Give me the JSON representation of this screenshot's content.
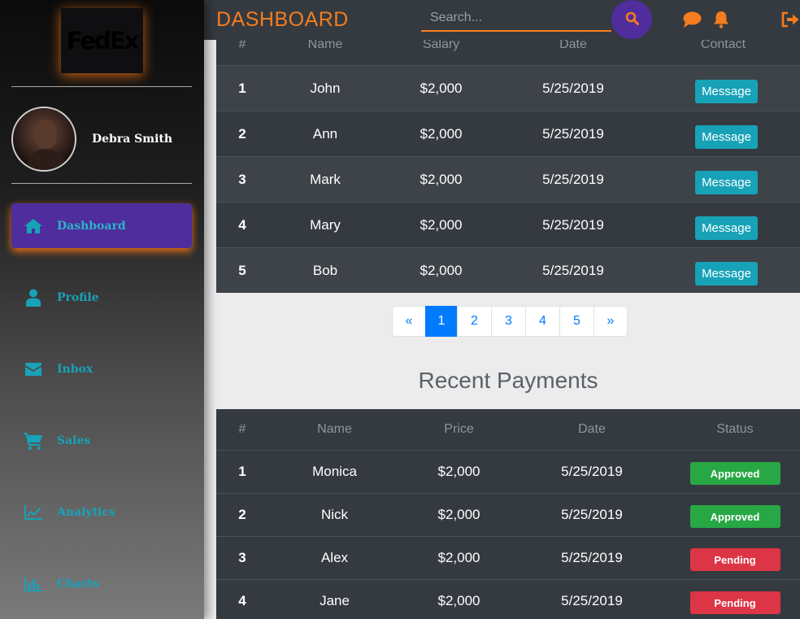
{
  "sidebar": {
    "logo": "FedEx",
    "user_name": "Debra Smith",
    "items": [
      {
        "label": "Dashboard",
        "icon": "home-icon"
      },
      {
        "label": "Profile",
        "icon": "user-icon"
      },
      {
        "label": "Inbox",
        "icon": "envelope-icon"
      },
      {
        "label": "Sales",
        "icon": "cart-icon"
      },
      {
        "label": "Analytics",
        "icon": "line-chart-icon"
      },
      {
        "label": "Charts",
        "icon": "bar-chart-icon"
      }
    ]
  },
  "header": {
    "title": "DASHBOARD",
    "search_placeholder": "Search...",
    "accent_color": "#f57c1f"
  },
  "employees": {
    "columns": [
      "#",
      "Name",
      "Salary",
      "Date",
      "Contact"
    ],
    "button_label": "Message",
    "rows": [
      {
        "num": "1",
        "name": "John",
        "salary": "$2,000",
        "date": "5/25/2019"
      },
      {
        "num": "2",
        "name": "Ann",
        "salary": "$2,000",
        "date": "5/25/2019"
      },
      {
        "num": "3",
        "name": "Mark",
        "salary": "$2,000",
        "date": "5/25/2019"
      },
      {
        "num": "4",
        "name": "Mary",
        "salary": "$2,000",
        "date": "5/25/2019"
      },
      {
        "num": "5",
        "name": "Bob",
        "salary": "$2,000",
        "date": "5/25/2019"
      }
    ]
  },
  "pagination": {
    "prev": "«",
    "pages": [
      "1",
      "2",
      "3",
      "4",
      "5"
    ],
    "next": "»",
    "active_page": "1"
  },
  "payments": {
    "title": "Recent Payments",
    "columns": [
      "#",
      "Name",
      "Price",
      "Date",
      "Status"
    ],
    "rows": [
      {
        "num": "1",
        "name": "Monica",
        "price": "$2,000",
        "date": "5/25/2019",
        "status": "Approved"
      },
      {
        "num": "2",
        "name": "Nick",
        "price": "$2,000",
        "date": "5/25/2019",
        "status": "Approved"
      },
      {
        "num": "3",
        "name": "Alex",
        "price": "$2,000",
        "date": "5/25/2019",
        "status": "Pending"
      },
      {
        "num": "4",
        "name": "Jane",
        "price": "$2,000",
        "date": "5/25/2019",
        "status": "Pending"
      }
    ],
    "status_colors": {
      "Approved": "#28a745",
      "Pending": "#dc3545"
    }
  }
}
